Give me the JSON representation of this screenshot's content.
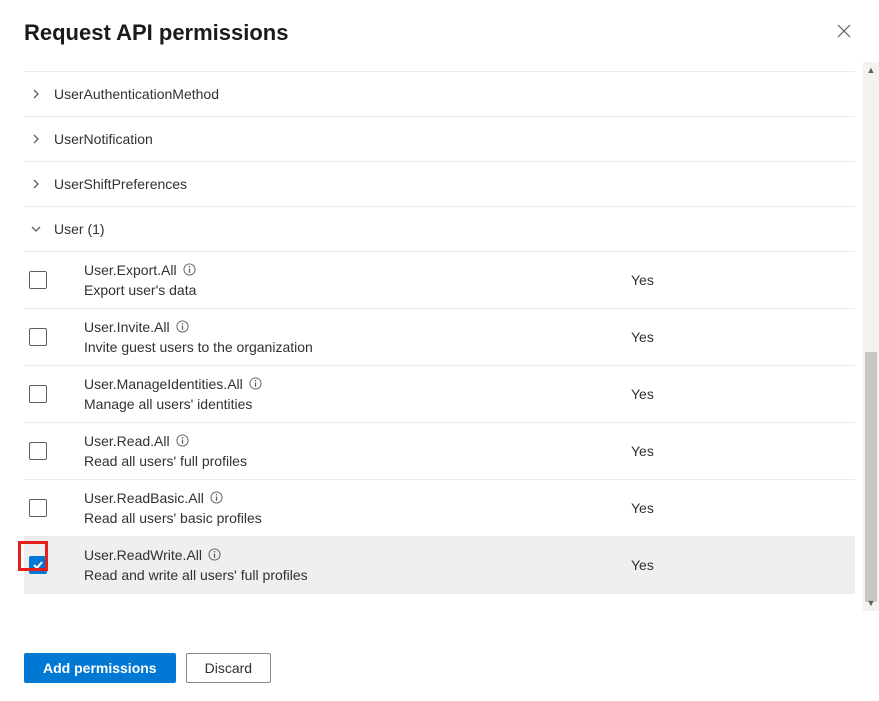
{
  "title": "Request API permissions",
  "groups": [
    {
      "label": "UserAuthenticationMethod",
      "expanded": false
    },
    {
      "label": "UserNotification",
      "expanded": false
    },
    {
      "label": "UserShiftPreferences",
      "expanded": false
    },
    {
      "label": "User (1)",
      "expanded": true
    }
  ],
  "permissions": [
    {
      "name": "User.Export.All",
      "desc": "Export user's data",
      "admin": "Yes",
      "checked": false
    },
    {
      "name": "User.Invite.All",
      "desc": "Invite guest users to the organization",
      "admin": "Yes",
      "checked": false
    },
    {
      "name": "User.ManageIdentities.All",
      "desc": "Manage all users' identities",
      "admin": "Yes",
      "checked": false
    },
    {
      "name": "User.Read.All",
      "desc": "Read all users' full profiles",
      "admin": "Yes",
      "checked": false
    },
    {
      "name": "User.ReadBasic.All",
      "desc": "Read all users' basic profiles",
      "admin": "Yes",
      "checked": false
    },
    {
      "name": "User.ReadWrite.All",
      "desc": "Read and write all users' full profiles",
      "admin": "Yes",
      "checked": true
    }
  ],
  "actions": {
    "primary": "Add permissions",
    "secondary": "Discard"
  }
}
